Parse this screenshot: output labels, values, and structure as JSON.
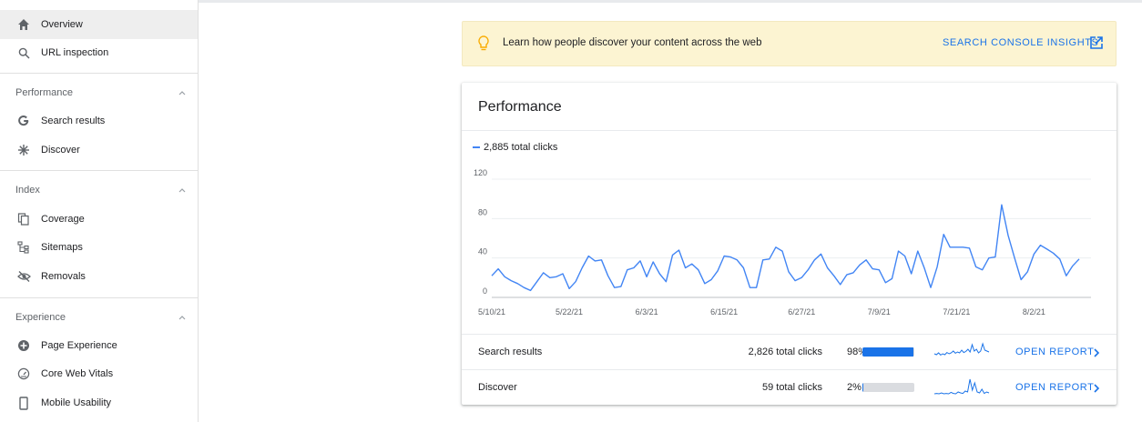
{
  "sidebar": {
    "top_items": [
      {
        "label": "Overview",
        "icon": "home-icon",
        "active": true
      },
      {
        "label": "URL inspection",
        "icon": "search-icon",
        "active": false
      }
    ],
    "sections": [
      {
        "title": "Performance",
        "items": [
          {
            "label": "Search results",
            "icon": "google-g-icon"
          },
          {
            "label": "Discover",
            "icon": "asterisk-icon"
          }
        ]
      },
      {
        "title": "Index",
        "items": [
          {
            "label": "Coverage",
            "icon": "copy-icon"
          },
          {
            "label": "Sitemaps",
            "icon": "sitemap-icon"
          },
          {
            "label": "Removals",
            "icon": "hidden-eye-icon"
          }
        ]
      },
      {
        "title": "Experience",
        "items": [
          {
            "label": "Page Experience",
            "icon": "plus-circle-icon"
          },
          {
            "label": "Core Web Vitals",
            "icon": "speedometer-icon"
          },
          {
            "label": "Mobile Usability",
            "icon": "phone-icon"
          }
        ]
      }
    ]
  },
  "banner": {
    "message": "Learn how people discover your content across the web",
    "cta": "SEARCH CONSOLE INSIGHTS",
    "color": "#fcf4d2"
  },
  "performance": {
    "title": "Performance",
    "legend": "2,885 total clicks",
    "rows": [
      {
        "name": "Search results",
        "clicks": "2,826 total clicks",
        "pct": "98%",
        "share": 0.98,
        "open": "OPEN REPORT"
      },
      {
        "name": "Discover",
        "clicks": "59 total clicks",
        "pct": "2%",
        "share": 0.02,
        "open": "OPEN REPORT"
      }
    ]
  },
  "chart_data": {
    "type": "line",
    "ylim": [
      0,
      120
    ],
    "y_ticks": [
      "0",
      "40",
      "80",
      "120"
    ],
    "x_tick_labels": [
      "5/10/21",
      "5/22/21",
      "6/3/21",
      "6/15/21",
      "6/27/21",
      "7/9/21",
      "7/21/21",
      "8/2/21"
    ],
    "x_start": "5/10/21",
    "x_end": "8/13/21",
    "series": [
      {
        "color": "#4285f4",
        "values": [
          22,
          29,
          21,
          17,
          14,
          10,
          7,
          16,
          25,
          20,
          21,
          24,
          9,
          16,
          30,
          42,
          37,
          38,
          22,
          10,
          11,
          28,
          30,
          37,
          21,
          36,
          24,
          16,
          43,
          48,
          30,
          34,
          28,
          14,
          18,
          27,
          42,
          41,
          38,
          30,
          10,
          10,
          38,
          39,
          51,
          47,
          26,
          17,
          20,
          28,
          38,
          44,
          30,
          22,
          13,
          23,
          25,
          33,
          38,
          29,
          28,
          15,
          19,
          47,
          42,
          24,
          47,
          30,
          10,
          31,
          64,
          51,
          51,
          51,
          50,
          31,
          28,
          40,
          41,
          94,
          63,
          40,
          18,
          26,
          44,
          53,
          49,
          45,
          39,
          22,
          32,
          39
        ]
      }
    ]
  },
  "sparklines": {
    "search": [
      0.35,
      0.3,
      0.4,
      0.28,
      0.35,
      0.3,
      0.42,
      0.35,
      0.4,
      0.5,
      0.38,
      0.45,
      0.4,
      0.55,
      0.42,
      0.48,
      0.6,
      0.45,
      0.85,
      0.5,
      0.6,
      0.4,
      0.5,
      0.9,
      0.55,
      0.5,
      0.45
    ],
    "discover": [
      0.1,
      0.12,
      0.1,
      0.15,
      0.1,
      0.12,
      0.1,
      0.18,
      0.12,
      0.1,
      0.2,
      0.15,
      0.12,
      0.25,
      0.2,
      0.9,
      0.3,
      0.7,
      0.2,
      0.15,
      0.35,
      0.12,
      0.2,
      0.15
    ]
  }
}
